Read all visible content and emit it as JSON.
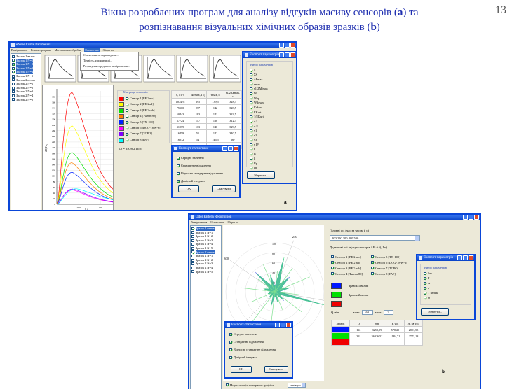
{
  "slide": {
    "title_line1_a": "Вікна розроблених програм для аналізу відгуків масиву сенсорів (",
    "title_a": "a",
    "title_line1_b": ") та",
    "title_line2_a": "розпізнавання візуальних хімічних образів зразків (",
    "title_b": "b",
    "title_line2_b": ")",
    "page_number": "13",
    "label_a": "a",
    "label_b": "b"
  },
  "win_a": {
    "title": "eNose Curve Parameters",
    "menu": [
      "Вимірювання",
      "Режим програми",
      "Математична обробка",
      "Статистика",
      "Зберегти"
    ],
    "dropdown": [
      "Статистика за параметрами...",
      "Точність апроксимації...",
      "Розрахунок середнього вимірювання..."
    ],
    "samples": [
      {
        "label": "Зразок 1 велик",
        "checked": false,
        "selected": false
      },
      {
        "label": "Зразок 1 N=1",
        "checked": true,
        "selected": true
      },
      {
        "label": "Зразок 1 N=2",
        "checked": true,
        "selected": true
      },
      {
        "label": "Зразок 1 N=3",
        "checked": true,
        "selected": true
      },
      {
        "label": "Зразок 1 N=4",
        "checked": true,
        "selected": true
      },
      {
        "label": "Зразок 1 N=5",
        "checked": false,
        "selected": false
      },
      {
        "label": "Зразок 2 велик",
        "checked": false,
        "selected": false
      },
      {
        "label": "Зразок 2 N=1",
        "checked": false,
        "selected": false
      },
      {
        "label": "Зразок 2 N=2",
        "checked": false,
        "selected": false
      },
      {
        "label": "Зразок 2 N=3",
        "checked": false,
        "selected": false
      },
      {
        "label": "Зразок 2 N=4",
        "checked": false,
        "selected": false
      },
      {
        "label": "Зразок 2 N=5",
        "checked": false,
        "selected": false
      }
    ],
    "matrix_title": "Матриця сенсорів",
    "sensors": [
      {
        "label": "Сенсор 1 [PEG mc]",
        "color": "#ff0000"
      },
      {
        "label": "Сенсор 2 [PEG ad]",
        "color": "#ffff00"
      },
      {
        "label": "Сенсор 3 [PEG seb]",
        "color": "#00e000"
      },
      {
        "label": "Сенсор 4 [Tween 80]",
        "color": "#ff8000"
      },
      {
        "label": "Сенсор 5 [TX-100]",
        "color": "#0020ff"
      },
      {
        "label": "Сенсор 6 [DCG-18-K-6]",
        "color": "#ff00ff"
      },
      {
        "label": "Сенсор 7 [TOPO]",
        "color": "#8000ff"
      },
      {
        "label": "Сенсор 8 [BW]",
        "color": "#00ffff"
      }
    ],
    "table_headers": [
      "S, Гц·с",
      "ΔFmax, Гц",
      "τmax, с",
      "τ1/2ΔFmax, с"
    ],
    "table_rows": [
      [
        "107478",
        "395",
        "139,5",
        "328,5"
      ],
      [
        "75100",
        "277",
        "142",
        "328,5"
      ],
      [
        "50443",
        "183",
        "141",
        "333,5"
      ],
      [
        "37724",
        "147",
        "138",
        "312,5"
      ],
      [
        "31079",
        "113",
        "140",
        "329,5"
      ],
      [
        "16459",
        "51",
        "142",
        "340,5"
      ],
      [
        "16012",
        "54",
        "146,5",
        "367"
      ],
      [
        "18600",
        "55",
        "179",
        "436"
      ]
    ],
    "sum_label": "ΣS = 350902 Гц·с",
    "chart_data": {
      "type": "line",
      "xlabel": "t, c",
      "ylabel": "ΔF, Гц",
      "ylim": [
        0,
        400
      ],
      "y_ticks": [
        "0",
        "20",
        "40",
        "60",
        "80",
        "100",
        "120",
        "140",
        "160",
        "180",
        "200",
        "220",
        "240",
        "260",
        "280",
        "300",
        "320",
        "340",
        "360",
        "380"
      ],
      "x_ticks": [
        "200",
        "400"
      ],
      "xlim": [
        0,
        600
      ],
      "series_peaks": [
        395,
        277,
        183,
        147,
        113,
        51,
        54,
        55
      ],
      "peak_times": [
        139.5,
        142,
        141,
        138,
        140,
        142,
        146.5,
        179
      ]
    },
    "stats_dialog": {
      "title": "Експорт статистики",
      "options": [
        "Середнє значення",
        "Стандартне відхилення",
        "Відносне стандартне відхилення",
        "Довірчий інтервал"
      ],
      "ok": "OK",
      "cancel": "Скасувати"
    },
    "params_dialog": {
      "title": "Експорт параметрів",
      "group": "Вибір параметрів",
      "params": [
        "S",
        "ΣS",
        "ΔFmax",
        "τmax",
        "τ1/2ΔFmax",
        "W",
        "Wup",
        "Wdown",
        "Kskew",
        "EKurt",
        "1/EKurt",
        "α L",
        "α F",
        "v1",
        "v2",
        "v3",
        "τ IP",
        "L",
        "R",
        "k",
        "Rp",
        "kp"
      ],
      "save": "Зберегти..."
    }
  },
  "win_b": {
    "title": "Odor Pattern Recognition",
    "menu": [
      "Вимірювання",
      "Статистика",
      "Зберегти"
    ],
    "samples": [
      {
        "label": "Зразок 1 велик",
        "checked": true,
        "selected": true
      },
      {
        "label": "Зразок 1 N=1",
        "checked": false
      },
      {
        "label": "Зразок 1 N=2",
        "checked": false
      },
      {
        "label": "Зразок 1 N=3",
        "checked": false
      },
      {
        "label": "Зразок 1 N=4",
        "checked": false
      },
      {
        "label": "Зразок 1 N=5",
        "checked": false
      },
      {
        "label": "Зразок 2 велик",
        "checked": true,
        "selected": true
      },
      {
        "label": "Зразок 2 N=1",
        "checked": false
      },
      {
        "label": "Зразок 2 N=2",
        "checked": false
      },
      {
        "label": "Зразок 2 N=3",
        "checked": false
      },
      {
        "label": "Зразок 2 N=4",
        "checked": false
      },
      {
        "label": "Зразок 2 N=5",
        "checked": false
      }
    ],
    "radar": {
      "radial_ticks": [
        "20",
        "40",
        "60",
        "80",
        "100"
      ],
      "angle_labels": [
        "250",
        "200",
        "300",
        "400"
      ]
    },
    "main_axes_label": "Головні осі (час за часом t, с)",
    "main_axes_value": "200 250 300 400 500",
    "extra_axes_label": "Додаткові осі (відгук сенсорів ΔFi (t i), Гц)",
    "sensors": [
      {
        "label": "Сенсор 1 [PEG mc]",
        "checked": false
      },
      {
        "label": "Сенсор 2 [PEG ad]",
        "checked": true
      },
      {
        "label": "Сенсор 3 [PEG seb]",
        "checked": true
      },
      {
        "label": "Сенсор 4 [Tween 80]",
        "checked": true
      },
      {
        "label": "Сенсор 5 [TX-100]",
        "checked": true
      },
      {
        "label": "Сенсор 6 [DCG-18-K-6]",
        "checked": true
      },
      {
        "label": "Сенсор 7 [TOPO]",
        "checked": true
      },
      {
        "label": "Сенсор 8 [BW]",
        "checked": true
      }
    ],
    "legend": [
      {
        "label": "Зразок 1 велик",
        "color": "#0018ff"
      },
      {
        "label": "Зразок 2 велик",
        "color": "#00e000"
      },
      {
        "label": "",
        "color": "#f00000"
      }
    ],
    "q_label": "Q   мін",
    "max_label": "макс",
    "max_value": "60",
    "step_label": "крок",
    "step_value": "3",
    "table_headers": [
      "Зразок",
      "Q",
      "Sm",
      "P, у.о.",
      "A, вв у.о."
    ],
    "table_rows": [
      {
        "color": "#0018ff",
        "cells": [
          "141",
          "3252,09",
          "578,29",
          "2801,55"
        ]
      },
      {
        "color": "#00e000",
        "cells": [
          "341",
          "36026,52",
          "1184,71",
          "2773,18"
        ]
      },
      {
        "color": "#f00000",
        "cells": [
          "",
          "",
          "",
          ""
        ]
      }
    ],
    "normalize_label": "Нормалізація полярного графіка",
    "normalize_select": "мінімум",
    "stats_dialog": {
      "title": "Експорт статистики",
      "options": [
        "Середнє значення",
        "Стандартне відхилення",
        "Відносне стандартне відхилення",
        "Довірчий інтервал"
      ],
      "ok": "OK",
      "cancel": "Скасувати"
    },
    "params_dialog": {
      "title": "Експорт параметрів",
      "group": "Вибір параметрів",
      "params": [
        "Sm",
        "P",
        "A",
        "σ",
        "T велик",
        "Q"
      ],
      "save": "Зберегти..."
    }
  }
}
